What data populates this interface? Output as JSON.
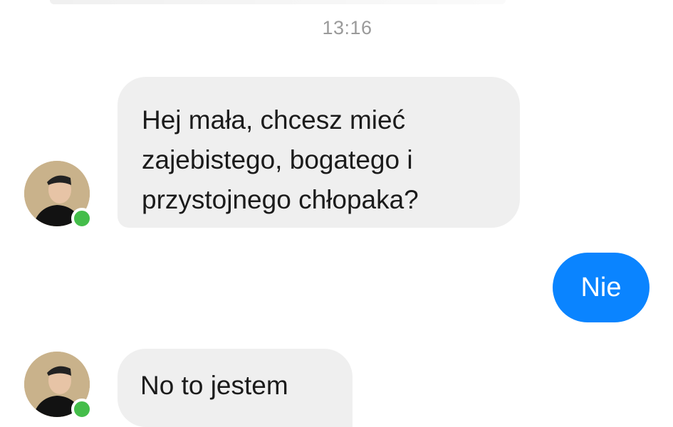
{
  "conversation": {
    "timestamp": "13:16",
    "messages": [
      {
        "id": "msg-1",
        "direction": "incoming",
        "lines": [
          "Hej mała, chcesz mieć",
          "zajebistego, bogatego i",
          "przystojnego chłopaka?"
        ]
      },
      {
        "id": "msg-2",
        "direction": "outgoing",
        "text": "Nie"
      },
      {
        "id": "msg-3",
        "direction": "incoming",
        "text": "No to jestem"
      }
    ]
  },
  "colors": {
    "incoming_bubble": "#efefef",
    "outgoing_bubble": "#0a84ff",
    "online_indicator": "#44bd4a",
    "timestamp_text": "#9a9a9a"
  },
  "icons": {
    "avatar": "avatar-icon",
    "online_status": "online-status-icon"
  }
}
